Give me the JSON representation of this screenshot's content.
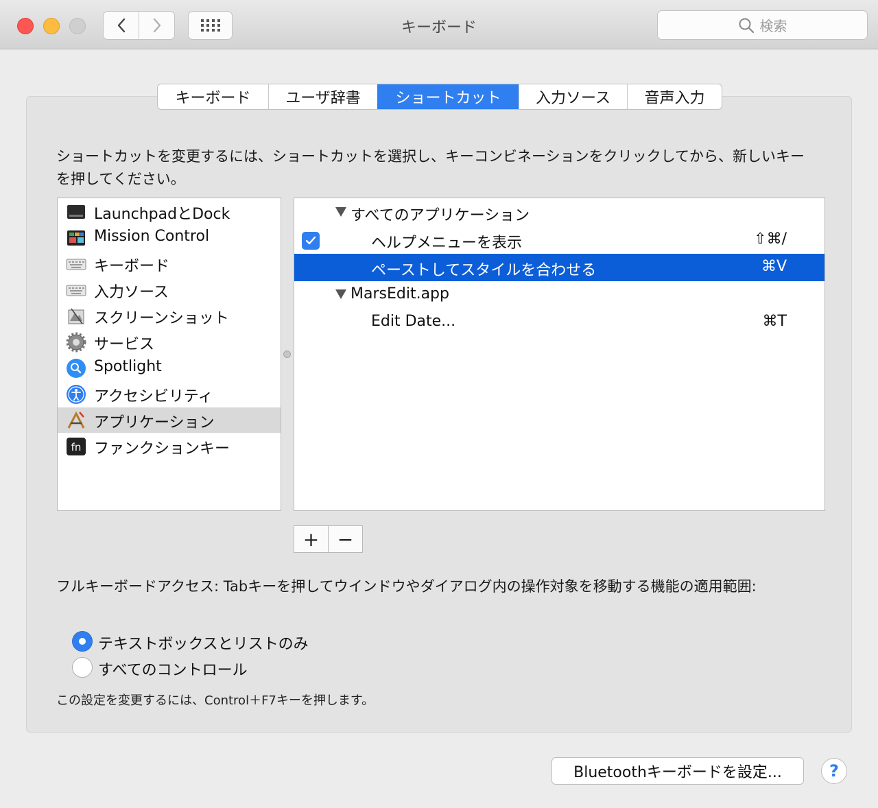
{
  "window": {
    "title": "キーボード",
    "search_placeholder": "検索"
  },
  "tabs": [
    {
      "label": "キーボード",
      "active": false
    },
    {
      "label": "ユーザ辞書",
      "active": false
    },
    {
      "label": "ショートカット",
      "active": true
    },
    {
      "label": "入力ソース",
      "active": false
    },
    {
      "label": "音声入力",
      "active": false
    }
  ],
  "instructions": "ショートカットを変更するには、ショートカットを選択し、キーコンビネーションをクリックしてから、新しいキーを押してください。",
  "categories": [
    {
      "label": "LaunchpadとDock",
      "icon": "launchpad-dock-icon"
    },
    {
      "label": "Mission Control",
      "icon": "mission-control-icon"
    },
    {
      "label": "キーボード",
      "icon": "keyboard-icon"
    },
    {
      "label": "入力ソース",
      "icon": "input-source-icon"
    },
    {
      "label": "スクリーンショット",
      "icon": "screenshot-icon"
    },
    {
      "label": "サービス",
      "icon": "gear-icon"
    },
    {
      "label": "Spotlight",
      "icon": "spotlight-icon"
    },
    {
      "label": "アクセシビリティ",
      "icon": "accessibility-icon"
    },
    {
      "label": "アプリケーション",
      "icon": "app-store-icon",
      "selected": true
    },
    {
      "label": "ファンクションキー",
      "icon": "fn-key-icon"
    }
  ],
  "shortcuts": {
    "group1": "すべてのアプリケーション",
    "item1": {
      "label": "ヘルプメニューを表示",
      "keys": "⇧⌘/",
      "checked": true
    },
    "item2": {
      "label": "ペーストしてスタイルを合わせる",
      "keys": "⌘V",
      "selected": true
    },
    "group2": "MarsEdit.app",
    "item3": {
      "label": "Edit Date...",
      "keys": "⌘T"
    }
  },
  "buttons": {
    "add": "+",
    "remove": "−",
    "bluetooth": "Bluetoothキーボードを設定...",
    "help": "?"
  },
  "full_keyboard_access": {
    "description": "フルキーボードアクセス: Tabキーを押してウインドウやダイアログ内の操作対象を移動する機能の適用範囲:",
    "options": [
      {
        "label": "テキストボックスとリストのみ",
        "selected": true
      },
      {
        "label": "すべてのコントロール",
        "selected": false
      }
    ],
    "note": "この設定を変更するには、Control＋F7キーを押します。"
  },
  "colors": {
    "accent": "#2f7ff0",
    "selection": "#0c5ed8",
    "close": "#fc5753",
    "minimize": "#fdbc40"
  }
}
